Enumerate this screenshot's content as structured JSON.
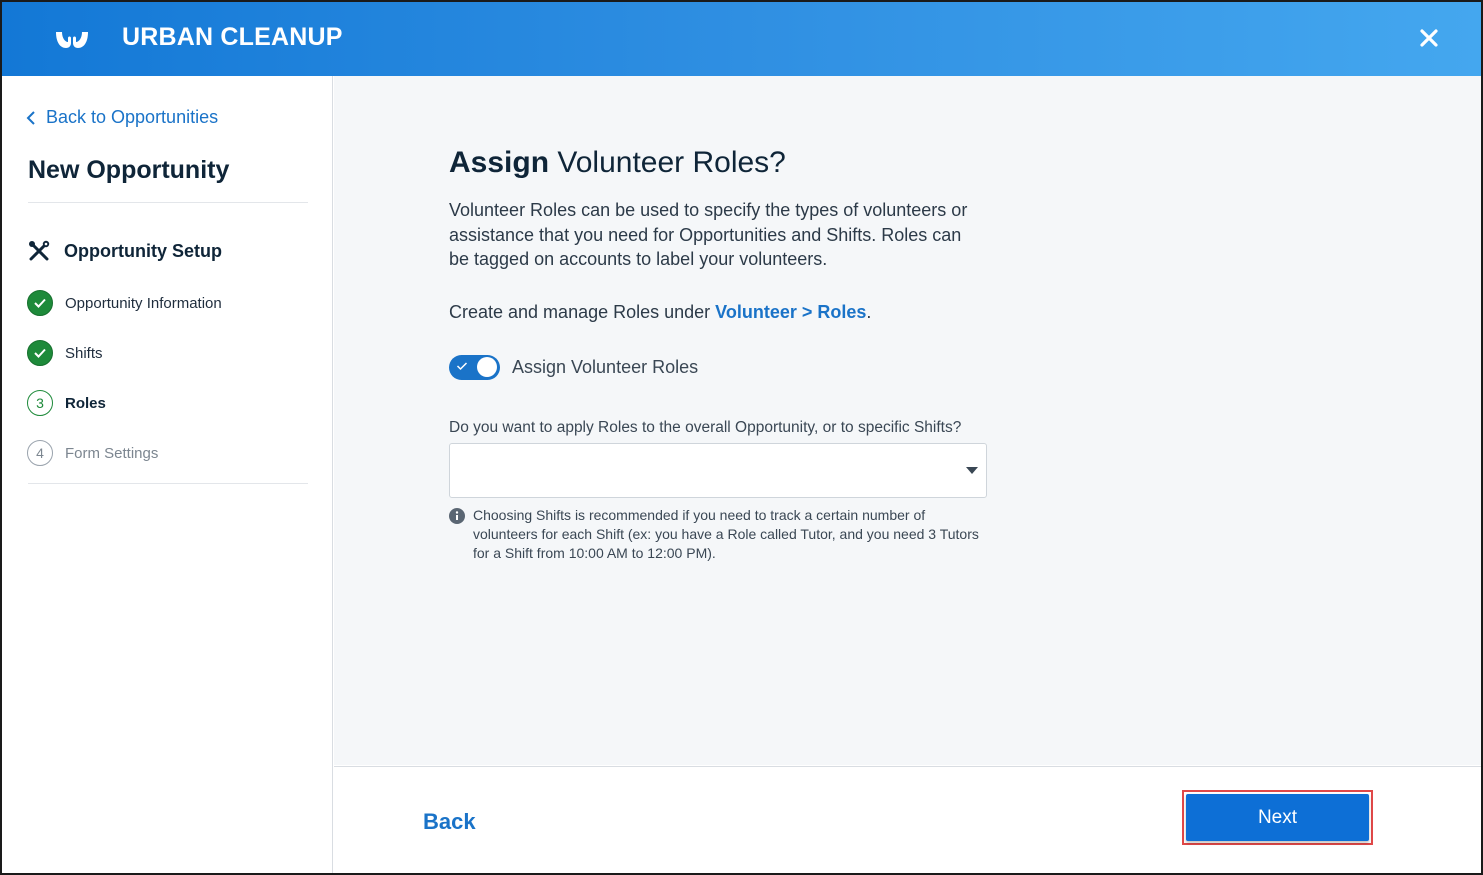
{
  "header": {
    "logo_icon": "hands-logo-icon",
    "app_title": "URBAN CLEANUP",
    "close_icon": "close-icon"
  },
  "sidebar": {
    "back_label": "Back to Opportunities",
    "page_title": "New Opportunity",
    "section_label": "Opportunity Setup",
    "section_icon": "tools-icon",
    "steps": [
      {
        "number": "1",
        "label": "Opportunity Information",
        "status": "complete"
      },
      {
        "number": "2",
        "label": "Shifts",
        "status": "complete"
      },
      {
        "number": "3",
        "label": "Roles",
        "status": "current"
      },
      {
        "number": "4",
        "label": "Form Settings",
        "status": "upcoming"
      }
    ]
  },
  "main": {
    "heading_bold": "Assign",
    "heading_rest": " Volunteer Roles?",
    "description": "Volunteer Roles can be used to specify the types of volunteers or assistance that you need for Opportunities and Shifts. Roles can be tagged on accounts to label your volunteers.",
    "manage_prefix": "Create and manage Roles under ",
    "manage_link": "Volunteer > Roles",
    "manage_suffix": ".",
    "toggle_label": "Assign Volunteer Roles",
    "toggle_on": true,
    "question": "Do you want to apply Roles to the overall Opportunity, or to specific Shifts?",
    "select_value": "",
    "hint": "Choosing Shifts is recommended if you need to track a certain number of volunteers for each Shift (ex: you have a Role called Tutor, and you need 3 Tutors for a Shift from 10:00 AM to 12:00 PM)."
  },
  "footer": {
    "back_label": "Back",
    "next_label": "Next"
  },
  "colors": {
    "header_start": "#1378d6",
    "header_end": "#44a7ef",
    "accent": "#1a73c8",
    "success": "#1e8a3a",
    "highlight_border": "#e04848"
  }
}
